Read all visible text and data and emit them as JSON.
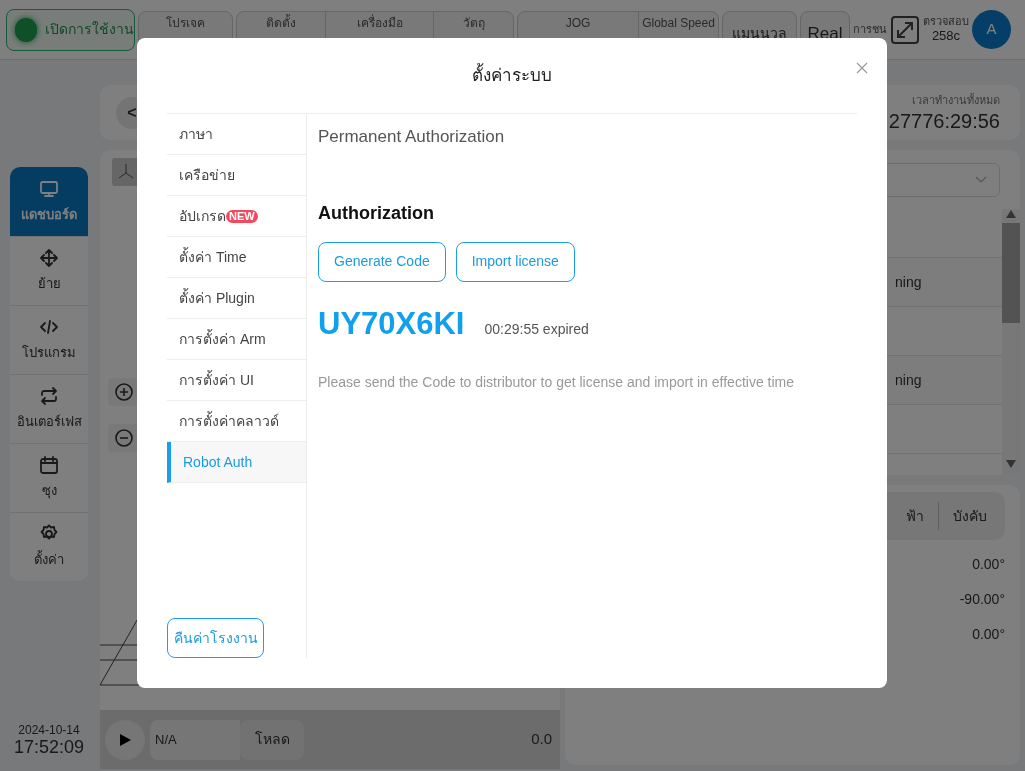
{
  "top_bar": {
    "enable_button": "เปิดการใช้งาน",
    "status_groups": [
      [
        "โปรเจค"
      ],
      [
        "ติดตั้ง",
        "เครื่องมือ",
        "วัตถุ"
      ],
      [
        "JOG",
        "Global Speed"
      ]
    ],
    "mode_buttons": [
      "แมนนวล",
      "Real"
    ],
    "collision": {
      "label": "การชน"
    },
    "check": {
      "label": "ตรวจสอบ",
      "value": "258c"
    },
    "avatar": "A"
  },
  "sidebar": {
    "items": [
      {
        "label": "แดชบอร์ด",
        "selected": true
      },
      {
        "label": "ย้าย",
        "selected": false
      },
      {
        "label": "โปรแกรม",
        "selected": false
      },
      {
        "label": "อินเตอร์เฟส",
        "selected": false
      },
      {
        "label": "ซุง",
        "selected": false
      },
      {
        "label": "ตั้งค่า",
        "selected": false
      }
    ],
    "date": "2024-10-14",
    "time": "17:52:09"
  },
  "view": {
    "back_button": "<"
  },
  "program_bar": {
    "program": "N/A",
    "load_button": "โหลด",
    "value": "0.0"
  },
  "runtime": {
    "label": "เวลาทำงานทั้งหมด",
    "value": "27776:29:56"
  },
  "task_list": {
    "rows": [
      {
        "text": "ning"
      },
      {
        "text": "ning"
      }
    ]
  },
  "joints": {
    "tabs": [
      "ฟ้า",
      "บังคับ"
    ],
    "rows": [
      {
        "value": "0.00°"
      },
      {
        "value": "-90.00°"
      },
      {
        "value": "0.00°"
      }
    ]
  },
  "dialog": {
    "title": "ตั้งค่าระบบ",
    "menu": [
      {
        "label": "ภาษา",
        "selected": false
      },
      {
        "label": "เครือข่าย",
        "selected": false
      },
      {
        "label": "อัปเกรด",
        "badge": "NEW",
        "selected": false
      },
      {
        "label": "ตั้งค่า Time",
        "selected": false
      },
      {
        "label": "ตั้งค่า Plugin",
        "selected": false
      },
      {
        "label": "การตั้งค่า Arm",
        "selected": false
      },
      {
        "label": "การตั้งค่า UI",
        "selected": false
      },
      {
        "label": "การตั้งค่าคลาวด์",
        "selected": false
      },
      {
        "label": "Robot Auth",
        "selected": true
      }
    ],
    "reset_button": "คืนค่าโรงงาน",
    "heading": "Permanent Authorization",
    "section": "Authorization",
    "buttons": [
      "Generate Code",
      "Import license"
    ],
    "code": "UY70X6KI",
    "countdown": "00:29:55 expired",
    "note": "Please send the Code to distributor to get license and import in effective time"
  }
}
